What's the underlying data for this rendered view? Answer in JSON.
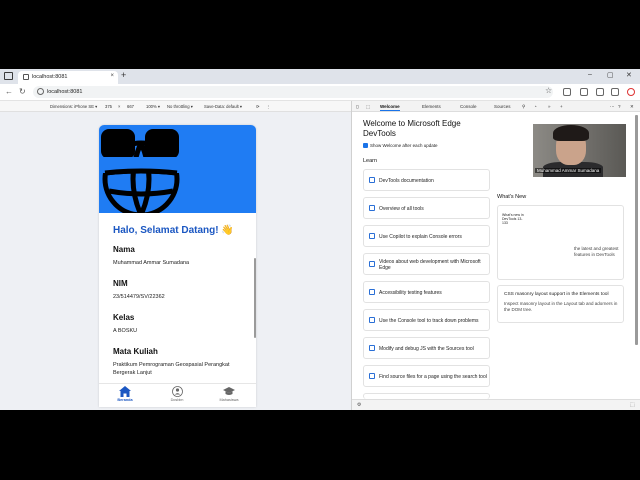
{
  "browser": {
    "tab_title": "localhost:8081",
    "tab_close": "×",
    "new_tab": "+",
    "url": "localhost:8081",
    "window_controls": [
      "–",
      "▢",
      "✕"
    ]
  },
  "device_toolbar": {
    "dimensions_label": "Dimensions: iPhone SE ▾",
    "width": "375",
    "times": "×",
    "height": "667",
    "zoom": "100% ▾",
    "throttle": "No throttling ▾",
    "save_data": "Save-Data: default ▾"
  },
  "app": {
    "greeting": "Halo, Selamat Datang!",
    "greeting_emoji": "👋",
    "fields": [
      {
        "label": "Nama",
        "value": "Muhammad Ammar Sumadana"
      },
      {
        "label": "NIM",
        "value": "23/514479/SV/22362"
      },
      {
        "label": "Kelas",
        "value": "A BOSKU"
      },
      {
        "label": "Mata Kuliah",
        "value": "Praktikum Pemrograman Geospasial Perangkat Bergerak Lanjut"
      }
    ],
    "bottom_nav": [
      {
        "label": "Beranda",
        "icon": "home-icon",
        "active": true
      },
      {
        "label": "Dosbim",
        "icon": "person-icon",
        "active": false
      },
      {
        "label": "Mahasiswa",
        "icon": "graduation-cap-icon",
        "active": false
      }
    ],
    "colors": {
      "hero": "#1f7cf3",
      "accent": "#1b57c2"
    }
  },
  "devtools": {
    "tabs": [
      "Welcome",
      "Elements",
      "Console",
      "Sources"
    ],
    "title": "Welcome to Microsoft Edge DevTools",
    "show_welcome": "Show Welcome after each update",
    "learn_heading": "Learn",
    "learn_items": [
      "DevTools documentation",
      "Overview of all tools",
      "Use Copilot to explain Console errors",
      "Videos about web development with Microsoft Edge",
      "Accessibility testing features",
      "Use the Console tool to track down problems",
      "Modify and debug JS with the Sources tool",
      "Find source files for a page using the search tool"
    ],
    "whats_new_heading": "What's New",
    "whats_new_mini": "What's new in DevTools 13-133",
    "whats_new_text": "the latest and greatest features in DevTools",
    "css_masonry_title": "CSS masonry layout support in the Elements tool",
    "css_masonry_desc": "Inspect masonry layout in the Layout tab and adorners in the DOM tree."
  },
  "webcam": {
    "name": "Muhammad Ammar Sumadana"
  }
}
